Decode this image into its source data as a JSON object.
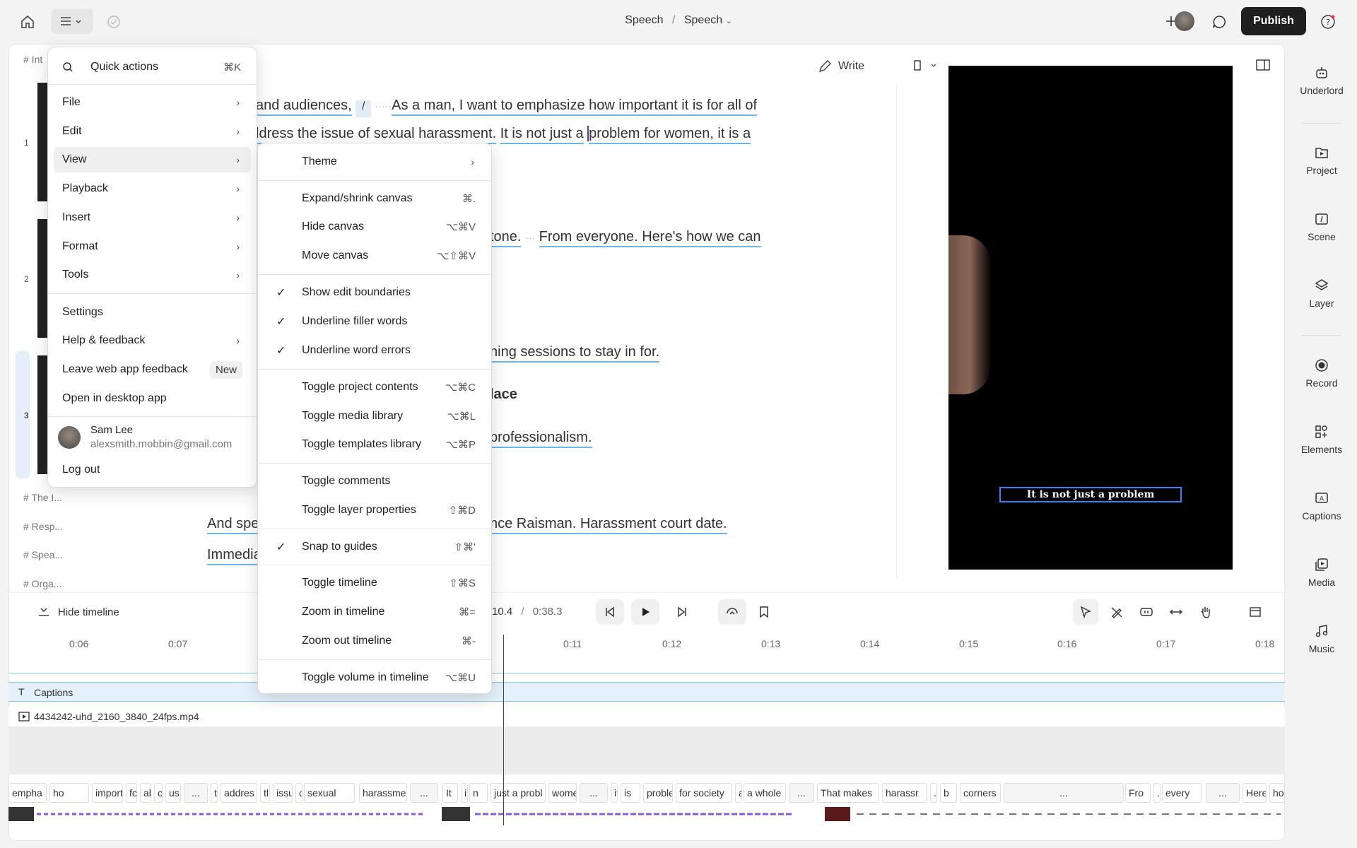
{
  "topbar": {
    "crumb_a": "Speech",
    "crumb_sep": "/",
    "crumb_b": "Speech",
    "publish": "Publish"
  },
  "rightbar": [
    {
      "label": "Underlord",
      "icon": "robot-icon"
    },
    {
      "label": "Project",
      "icon": "project-icon"
    },
    {
      "label": "Scene",
      "icon": "scene-icon"
    },
    {
      "label": "Layer",
      "icon": "layer-icon"
    },
    {
      "label": "Record",
      "icon": "record-icon"
    },
    {
      "label": "Elements",
      "icon": "elements-icon"
    },
    {
      "label": "Captions",
      "icon": "captions-icon"
    },
    {
      "label": "Media",
      "icon": "media-icon"
    },
    {
      "label": "Music",
      "icon": "music-icon"
    }
  ],
  "editor": {
    "write": "Write",
    "outline": [
      "# Int",
      "# The I...",
      "# Resp...",
      "# Spea...",
      "# Orga..."
    ],
    "scene_numbers": [
      "1",
      "2",
      "3"
    ],
    "line1_a": "and audiences,",
    "line1_b": "As a man, I want to emphasize how important it is for all of",
    "line2_a": "ldress the issue of sexual harassment.",
    "line2_b": "It is not just a",
    "line2_c": "problem for women, it is a",
    "line3_a": "tone.",
    "line3_b": "From everyone. Here's how we can",
    "line4": "ning sessions to stay in for.",
    "line5": "lace",
    "line6": "professionalism.",
    "line7_a": "And spe",
    "line7_b": "nce Raisman. Harassment court date.",
    "line8": "Immedia"
  },
  "preview": {
    "caption": "It is not just a problem"
  },
  "timeline": {
    "hide": "Hide timeline",
    "current": "10.4",
    "sep": "/",
    "total": "0:38.3",
    "ruler": [
      "0:06",
      "0:07",
      "0:11",
      "0:12",
      "0:13",
      "0:14",
      "0:15",
      "0:16",
      "0:17",
      "0:18"
    ],
    "captions_track": "Captions",
    "video_track": "4434242-uhd_2160_3840_24fps.mp4",
    "words": [
      "empha",
      "ho",
      "important",
      "fc",
      "al",
      "c",
      "us",
      "...",
      "tc",
      "addres",
      "tl",
      "issu",
      "o",
      "sexual",
      "harassme",
      "...",
      "It",
      "i",
      "n",
      "just a probl",
      "wome",
      "...",
      "it",
      "is",
      "proble",
      "for society",
      "a",
      "a whole",
      "...",
      "That makes",
      "harassr",
      ".",
      "b",
      "corners",
      "...",
      "Fro",
      ".",
      "every",
      "...",
      "Here",
      "ho"
    ]
  },
  "main_menu": {
    "search_label": "Quick actions",
    "search_kbd": "⌘K",
    "items": [
      "File",
      "Edit",
      "View",
      "Playback",
      "Insert",
      "Format",
      "Tools"
    ],
    "settings": "Settings",
    "help": "Help & feedback",
    "leave_feedback": "Leave web app feedback",
    "new_tag": "New",
    "desktop": "Open in desktop app",
    "user_name": "Sam Lee",
    "user_email": "alexsmith.mobbin@gmail.com",
    "logout": "Log out"
  },
  "view_menu": {
    "theme": "Theme",
    "items": [
      {
        "label": "Expand/shrink canvas",
        "kbd": "⌘."
      },
      {
        "label": "Hide canvas",
        "kbd": "⌥⌘V"
      },
      {
        "label": "Move canvas",
        "kbd": "⌥⇧⌘V"
      },
      {
        "label": "Show edit boundaries",
        "kbd": "",
        "checked": true
      },
      {
        "label": "Underline filler words",
        "kbd": "",
        "checked": true
      },
      {
        "label": "Underline word errors",
        "kbd": "",
        "checked": true
      },
      {
        "label": "Toggle project contents",
        "kbd": "⌥⌘C"
      },
      {
        "label": "Toggle media library",
        "kbd": "⌥⌘L"
      },
      {
        "label": "Toggle templates library",
        "kbd": "⌥⌘P"
      },
      {
        "label": "Toggle comments",
        "kbd": ""
      },
      {
        "label": "Toggle layer properties",
        "kbd": "⇧⌘D"
      },
      {
        "label": "Snap to guides",
        "kbd": "⇧⌘'",
        "checked": true
      },
      {
        "label": "Toggle timeline",
        "kbd": "⇧⌘S"
      },
      {
        "label": "Zoom in timeline",
        "kbd": "⌘="
      },
      {
        "label": "Zoom out timeline",
        "kbd": "⌘-"
      },
      {
        "label": "Toggle volume in timeline",
        "kbd": "⌥⌘U"
      }
    ]
  }
}
